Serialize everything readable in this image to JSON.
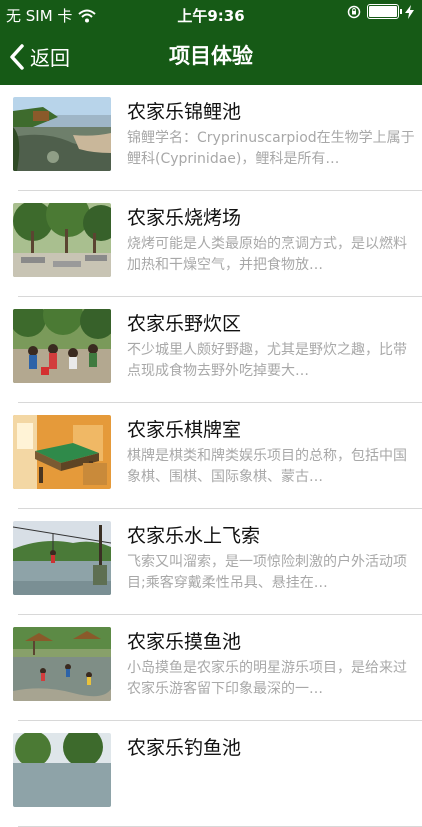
{
  "status_bar": {
    "carrier": "无 SIM 卡",
    "wifi_icon": "wifi-icon",
    "time": "上午9:36",
    "battery_level": 1.0,
    "icons": [
      "wifi-icon",
      "orientation-lock-icon",
      "battery-icon",
      "charging-icon"
    ]
  },
  "nav": {
    "back_label": "返回",
    "title": "项目体验",
    "back_icon": "chevron-left-icon"
  },
  "colors": {
    "header_bg": "#165a16",
    "title_text": "#111111",
    "desc_text": "#a8a8a8",
    "divider": "#d8d8d8"
  },
  "items": [
    {
      "title": "农家乐锦鲤池",
      "desc": "锦鲤学名：Cryprinuscarpiod在生物学上属于鲤科(Cyprinidae)，鲤科是所有…",
      "image": "koi-pond-photo"
    },
    {
      "title": "农家乐烧烤场",
      "desc": "烧烤可能是人类最原始的烹调方式，是以燃料加热和干燥空气，并把食物放…",
      "image": "bbq-area-photo"
    },
    {
      "title": "农家乐野炊区",
      "desc": "不少城里人颇好野趣，尤其是野炊之趣，比带点现成食物去野外吃掉要大…",
      "image": "picnic-area-photo"
    },
    {
      "title": "农家乐棋牌室",
      "desc": "棋牌是棋类和牌类娱乐项目的总称，包括中国象棋、围棋、国际象棋、蒙古…",
      "image": "card-room-photo"
    },
    {
      "title": "农家乐水上飞索",
      "desc": "飞索又叫溜索，是一项惊险刺激的户外活动项目;乘客穿戴柔性吊具、悬挂在…",
      "image": "zipline-photo"
    },
    {
      "title": "农家乐摸鱼池",
      "desc": "小岛摸鱼是农家乐的明星游乐项目，是给来过农家乐游客留下印象最深的一…",
      "image": "fishing-by-hand-photo"
    },
    {
      "title": "农家乐钓鱼池",
      "desc": "",
      "image": "fishing-pond-photo"
    }
  ]
}
